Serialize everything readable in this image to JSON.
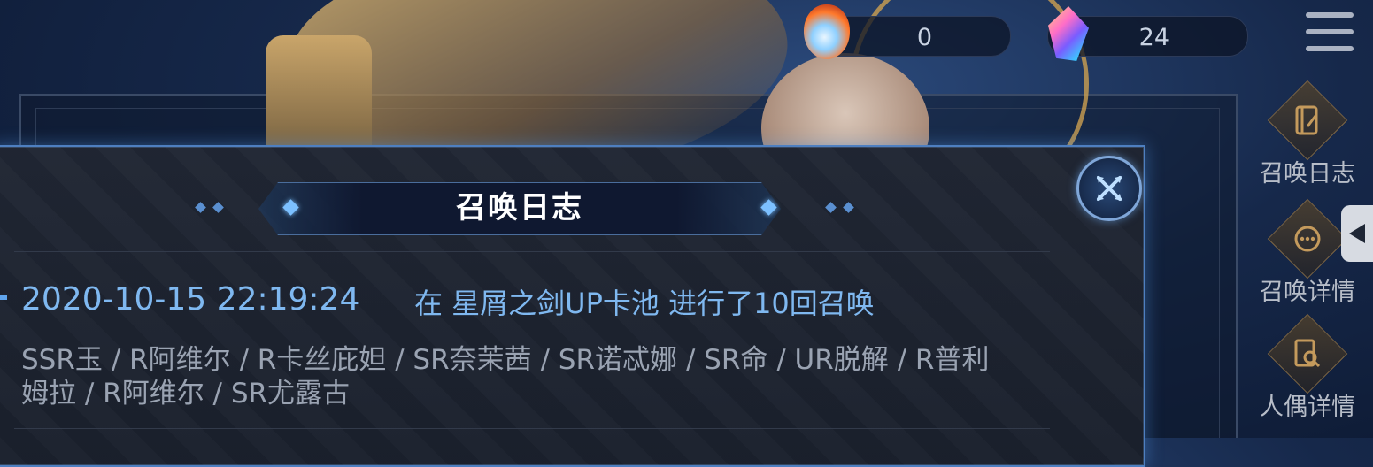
{
  "currencies": [
    {
      "icon": "fire-gem-icon",
      "value": "0"
    },
    {
      "icon": "crystal-icon",
      "value": "24"
    }
  ],
  "side_menu": [
    {
      "label": "召唤日志",
      "icon": "notebook-icon"
    },
    {
      "label": "召唤详情",
      "icon": "ellipsis-chat-icon"
    },
    {
      "label": "人偶详情",
      "icon": "search-document-icon"
    }
  ],
  "dialog": {
    "title": "召唤日志",
    "entries": [
      {
        "time": "2020-10-15 22:19:24",
        "description": "在 星屑之剑UP卡池 进行了10回召唤",
        "results": "SSR玉 / R阿维尔 / R卡丝庇妲 / SR奈茉茜 / SR诺忒娜 / SR命 / UR脱解 / R普利姆拉 / R阿维尔 / SR尤露古"
      }
    ]
  },
  "colors": {
    "accent_blue": "#7fb8f0",
    "panel_border": "#4e7fc0",
    "result_text": "#9aa3b2"
  }
}
